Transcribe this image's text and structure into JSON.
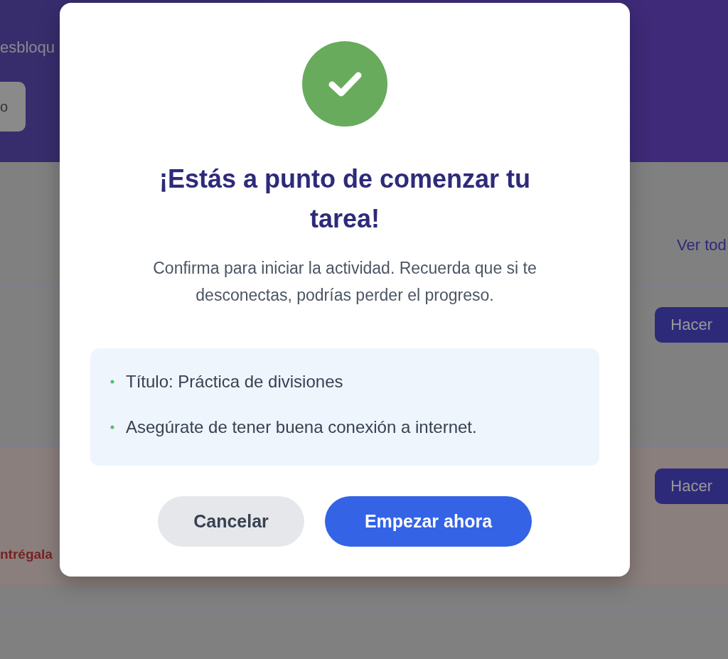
{
  "background": {
    "header": {
      "subtitle": "esbloqu",
      "button": "o"
    },
    "list": {
      "link": "Ver tod",
      "tasks": [
        {
          "action": "Hacer"
        },
        {
          "action": "Hacer",
          "note": "ntrégala"
        }
      ]
    }
  },
  "dialog": {
    "title": "¡Estás a punto de comenzar tu tarea!",
    "message": "Confirma para iniciar la actividad. Recuerda que si te desconectas, podrías perder el progreso.",
    "details": [
      "Título: Práctica de divisiones",
      "Asegúrate de tener buena conexión a internet."
    ],
    "buttons": [
      {
        "label": "Cancelar",
        "kind": "secondary"
      },
      {
        "label": "Empezar ahora",
        "kind": "primary"
      }
    ]
  }
}
